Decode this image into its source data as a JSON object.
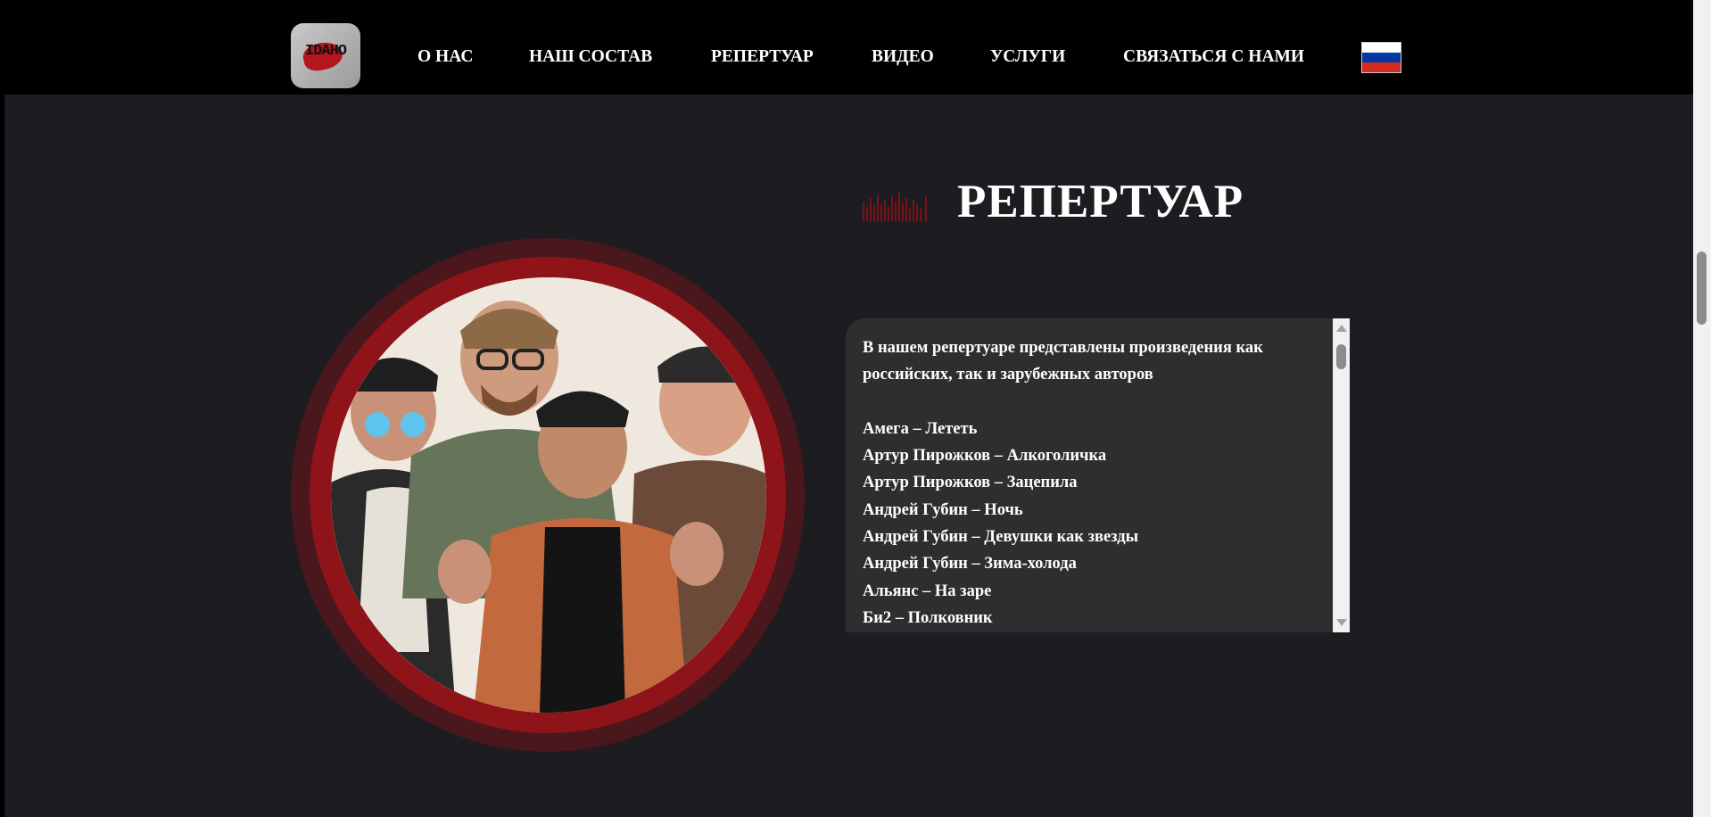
{
  "nav": {
    "logo_text": "IDAHO",
    "items": [
      {
        "label": "О НАС"
      },
      {
        "label": "НАШ СОСТАВ"
      },
      {
        "label": "РЕПЕРТУАР"
      },
      {
        "label": "ВИДЕО"
      },
      {
        "label": "УСЛУГИ"
      },
      {
        "label": "СВЯЗАТЬСЯ С НАМИ"
      }
    ],
    "language_flag": {
      "icon": "russian-flag-icon",
      "colors": [
        "#ffffff",
        "#0039a6",
        "#d52b1e"
      ]
    }
  },
  "section": {
    "title": "РЕПЕРТУАР",
    "intro": "В нашем репертуаре представлены произведения как российских, так и зарубежных авторов",
    "songs": [
      "Амега – Лететь",
      "Артур Пирожков – Алкоголичка",
      "Артур Пирожков – Зацепила",
      "Андрей Губин – Ночь",
      "Андрей Губин – Девушки как звезды",
      "Андрей Губин – Зима-холода",
      "Альянс – На заре",
      "Би2 – Полковник"
    ]
  },
  "colors": {
    "background": "#1c1c21",
    "navbar": "#000000",
    "accent_red": "#8e1419",
    "accent_dark_red": "#4a171c",
    "box": "#2e2e31"
  }
}
